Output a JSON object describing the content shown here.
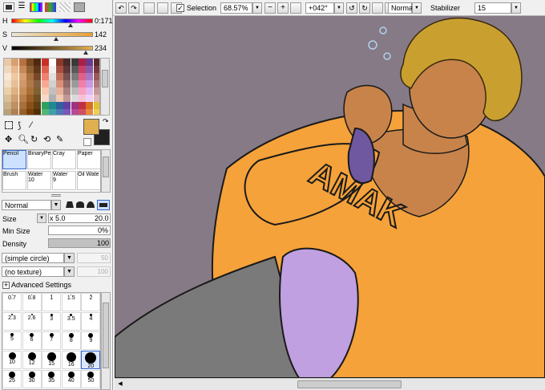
{
  "toolbar": {
    "selection_label": "Selection",
    "zoom": "68.57%",
    "rotation": "+042°",
    "blend_mode": "Normal",
    "stabilizer_label": "Stabilizer",
    "stabilizer_value": "15",
    "selection_checked": "✓"
  },
  "color": {
    "h_label": "H",
    "h_value": "0:171",
    "s_label": "S",
    "s_value": "142",
    "v_label": "V",
    "v_value": "234",
    "h_fraction": 0.73,
    "s_fraction": 0.55,
    "v_fraction": 0.91,
    "primary": "#e0b050",
    "secondary": "#202020"
  },
  "palette": {
    "swatches": [
      "#e9c8a8",
      "#d8a070",
      "#b87040",
      "#7a4a20",
      "#502810",
      "#c83028",
      "#fff",
      "#8a3a2a",
      "#4a2a28",
      "#3a3a3a",
      "#a82048",
      "#6a3a8a",
      "#5a2a2a",
      "#f0d8c0",
      "#e8b890",
      "#c88858",
      "#906030",
      "#603818",
      "#e06050",
      "#f0f0f0",
      "#a85040",
      "#603838",
      "#5a5a5a",
      "#c84068",
      "#8858a8",
      "#7a3a3a",
      "#f8e8d8",
      "#f0c8a0",
      "#d8a070",
      "#a87040",
      "#784828",
      "#f08070",
      "#e0e0e0",
      "#c07058",
      "#785050",
      "#7a7a7a",
      "#e06088",
      "#a878c8",
      "#9a5a5a",
      "#f0e0c8",
      "#e8c098",
      "#d09868",
      "#b07848",
      "#886040",
      "#f8a890",
      "#d0d0d0",
      "#d89078",
      "#906868",
      "#9a9a9a",
      "#f080a8",
      "#c898e0",
      "#b07878",
      "#e8d0a8",
      "#e0b080",
      "#c89058",
      "#a87038",
      "#806030",
      "#f8c8b0",
      "#c0c0c0",
      "#e8b098",
      "#a88080",
      "#bababa",
      "#f8a0c0",
      "#e0b8f0",
      "#c89898",
      "#d8c098",
      "#d0a070",
      "#b88048",
      "#986028",
      "#705020",
      "#f8d8c8",
      "#b0b0b0",
      "#f0c8b0",
      "#c09898",
      "#dadada",
      "#f8c0d8",
      "#f0d0f8",
      "#e0b8b8",
      "#c8b088",
      "#c09060",
      "#a87038",
      "#885018",
      "#604010",
      "#30a060",
      "#208890",
      "#3060a0",
      "#6040a0",
      "#a03080",
      "#c03040",
      "#d87020",
      "#e0c030",
      "#b8a078",
      "#b08050",
      "#986028",
      "#784008",
      "#503000",
      "#50b878",
      "#40a0a8",
      "#5078b8",
      "#7858b8",
      "#b84898",
      "#d05060",
      "#e88840",
      "#f0d050"
    ]
  },
  "tools_row1": [
    "",
    "",
    "",
    "",
    "",
    ""
  ],
  "brushes": [
    {
      "name": "Pencil",
      "size": ""
    },
    {
      "name": "BinaryPe",
      "size": ""
    },
    {
      "name": "Cray",
      "size": ""
    },
    {
      "name": "Paper",
      "size": ""
    },
    {
      "name": "Brush",
      "size": ""
    },
    {
      "name": "Water",
      "size": "10"
    },
    {
      "name": "Water",
      "size": "9"
    },
    {
      "name": "Oil Wate",
      "size": ""
    }
  ],
  "brush_settings": {
    "blend": "Normal",
    "size_label": "Size",
    "size_mult": "x 5.0",
    "size_value": "20.0",
    "min_size_label": "Min Size",
    "min_size_value": "0%",
    "min_size_fraction": 0,
    "density_label": "Density",
    "density_value": "100",
    "density_fraction": 1.0,
    "shape": "(simple circle)",
    "shape_value": "50",
    "texture": "(no texture)",
    "texture_value": "100",
    "advanced_label": "Advanced Settings",
    "advanced_icon": "+"
  },
  "size_presets": [
    {
      "v": "0.7",
      "d": 1
    },
    {
      "v": "0.8",
      "d": 1
    },
    {
      "v": "1",
      "d": 1
    },
    {
      "v": "1.5",
      "d": 1
    },
    {
      "v": "2",
      "d": 1
    },
    {
      "v": "2.3",
      "d": 2
    },
    {
      "v": "2.6",
      "d": 2
    },
    {
      "v": "3",
      "d": 3
    },
    {
      "v": "3.5",
      "d": 3
    },
    {
      "v": "4",
      "d": 3
    },
    {
      "v": "5",
      "d": 4
    },
    {
      "v": "6",
      "d": 5
    },
    {
      "v": "7",
      "d": 5
    },
    {
      "v": "8",
      "d": 6
    },
    {
      "v": "9",
      "d": 6
    },
    {
      "v": "10",
      "d": 9
    },
    {
      "v": "12",
      "d": 10
    },
    {
      "v": "15",
      "d": 11
    },
    {
      "v": "16",
      "d": 12
    },
    {
      "v": "20",
      "d": 14
    },
    {
      "v": "25",
      "d": 8
    },
    {
      "v": "30",
      "d": 8
    },
    {
      "v": "35",
      "d": 8
    },
    {
      "v": "40",
      "d": 8
    },
    {
      "v": "50",
      "d": 8
    }
  ],
  "canvas": {
    "bg": "#857a85",
    "artwork_text": "AMAK"
  }
}
